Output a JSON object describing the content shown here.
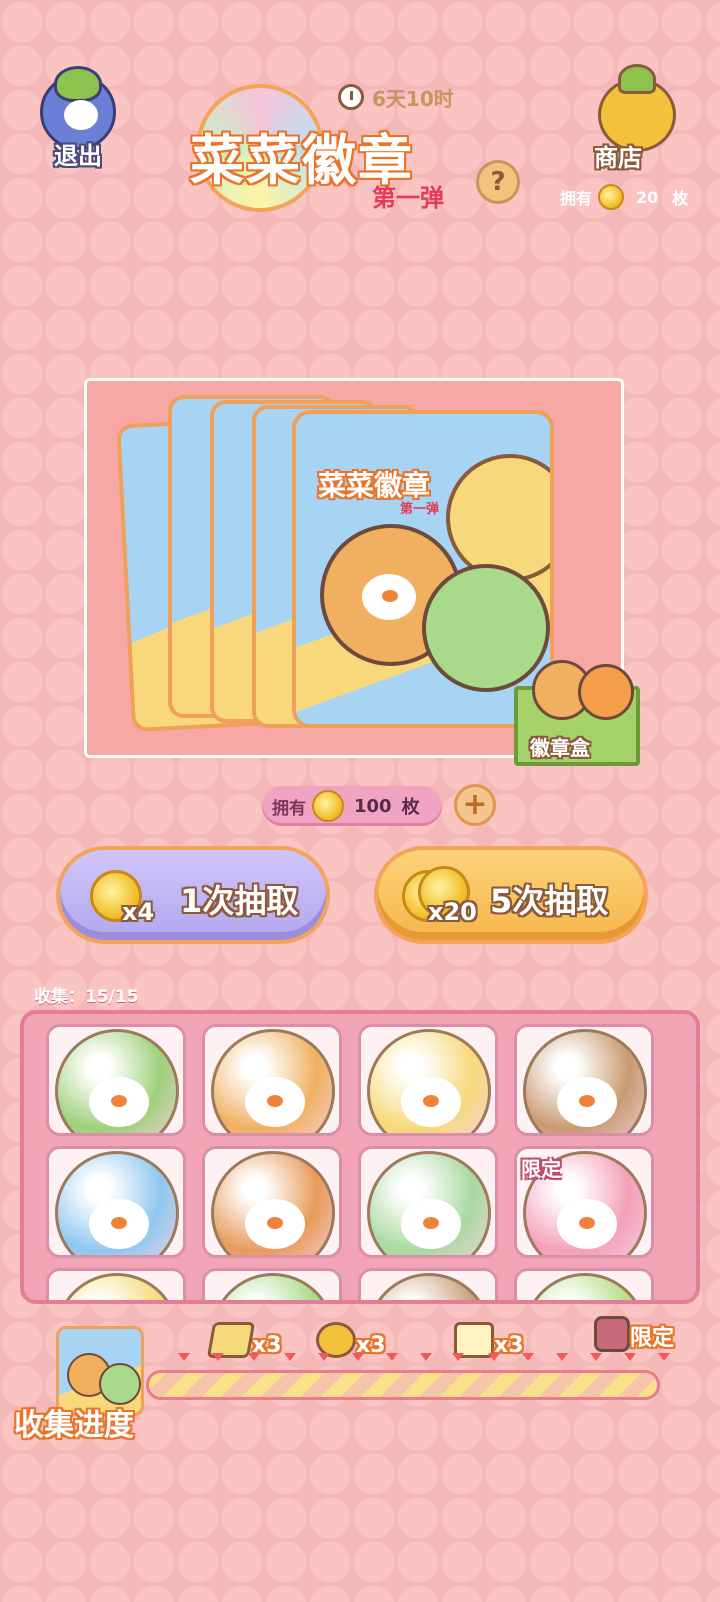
{
  "header": {
    "exit_label": "退出",
    "shop_label": "商店",
    "timer": "6天10时",
    "title_main": "菜菜徽章",
    "title_sub": "第一弹",
    "help_symbol": "?",
    "owned_prefix": "拥有",
    "owned_count": "20",
    "owned_unit": "枚"
  },
  "pack": {
    "pack_title": "菜菜徽章",
    "pack_subtitle": "第一弹",
    "box_label": "徽章盒"
  },
  "currency": {
    "owned_prefix": "拥有",
    "owned_count": "100",
    "owned_unit": "枚",
    "add_symbol": "+"
  },
  "draw_buttons": [
    {
      "cost": "x4",
      "label": "1次抽取",
      "color": "#b9aef0"
    },
    {
      "cost": "x20",
      "label": "5次抽取",
      "color": "#f9c25a"
    }
  ],
  "collection": {
    "label": "收集：15/15",
    "badges": [
      {
        "theme": "clover-chick",
        "color": "#9ed07a",
        "tag": ""
      },
      {
        "theme": "seed-chick",
        "color": "#f0b060",
        "tag": ""
      },
      {
        "theme": "pineapple-chick",
        "color": "#f6d97a",
        "tag": ""
      },
      {
        "theme": "chestnut-chick",
        "color": "#c99a70",
        "tag": ""
      },
      {
        "theme": "blue-hat-chick",
        "color": "#8fc7f0",
        "tag": ""
      },
      {
        "theme": "eggshell-chick",
        "color": "#e89a5a",
        "tag": ""
      },
      {
        "theme": "green-hat-chick",
        "color": "#a9d9a0",
        "tag": ""
      },
      {
        "theme": "pink-hat-chick",
        "color": "#f4a0b8",
        "tag": "限定"
      },
      {
        "theme": "yellow-chick",
        "color": "#f3dc7a",
        "tag": ""
      },
      {
        "theme": "green-chick",
        "color": "#a9d98a",
        "tag": ""
      },
      {
        "theme": "brown-chick",
        "color": "#c9a27a",
        "tag": ""
      },
      {
        "theme": "leaf-chick",
        "color": "#b8dc8a",
        "tag": ""
      }
    ]
  },
  "progress": {
    "label": "收集进度",
    "milestones": [
      {
        "reward": "x3",
        "icon": "cheese-icon"
      },
      {
        "reward": "x3",
        "icon": "pineapple-icon"
      },
      {
        "reward": "x3",
        "icon": "sprout-icon"
      },
      {
        "reward": "限定",
        "icon": "limited-icon"
      }
    ],
    "fill_fraction": 1.0
  }
}
